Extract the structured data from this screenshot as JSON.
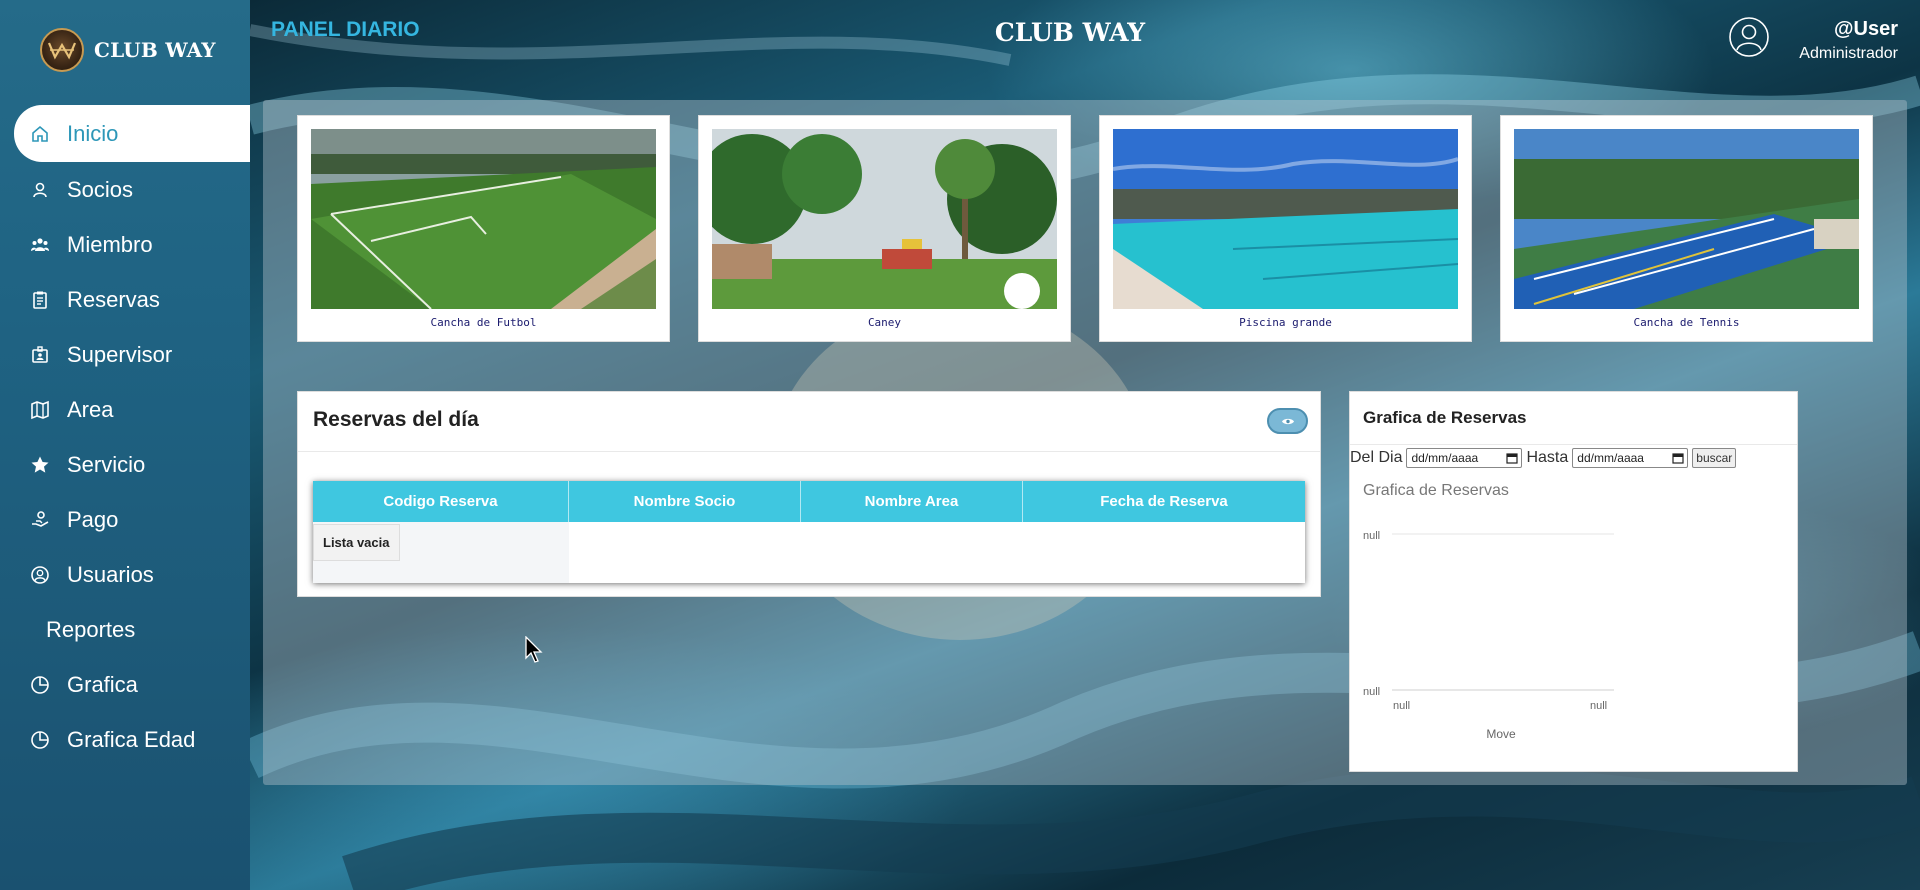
{
  "brand": {
    "name": "CLUB WAY",
    "logo_icon": "club-way-logo"
  },
  "header": {
    "panel_label": "PANEL DIARIO",
    "title": "CLUB WAY",
    "user_name": "@User",
    "user_role": "Administrador"
  },
  "sidebar": {
    "items": [
      {
        "label": "Inicio",
        "icon": "home-icon",
        "active": true
      },
      {
        "label": "Socios",
        "icon": "user-icon"
      },
      {
        "label": "Miembro",
        "icon": "members-icon"
      },
      {
        "label": "Reservas",
        "icon": "clipboard-icon"
      },
      {
        "label": "Supervisor",
        "icon": "id-badge-icon"
      },
      {
        "label": "Area",
        "icon": "map-icon"
      },
      {
        "label": "Servicio",
        "icon": "star-icon"
      },
      {
        "label": "Pago",
        "icon": "hand-coin-icon"
      },
      {
        "label": "Usuarios",
        "icon": "user-circle-icon"
      },
      {
        "label": "Reportes",
        "icon": ""
      },
      {
        "label": "Grafica",
        "icon": "pie-chart-icon"
      },
      {
        "label": "Grafica Edad",
        "icon": "pie-chart-icon"
      }
    ]
  },
  "areas": [
    {
      "caption": "Cancha de Futbol"
    },
    {
      "caption": "Caney"
    },
    {
      "caption": "Piscina grande"
    },
    {
      "caption": "Cancha de Tennis"
    }
  ],
  "reservas": {
    "title": "Reservas del día",
    "columns": [
      "Codigo Reserva",
      "Nombre Socio",
      "Nombre Area",
      "Fecha de Reserva"
    ],
    "empty_text": "Lista vacia"
  },
  "grafica": {
    "title": "Grafica de Reservas",
    "from_label": "Del Dia",
    "from_placeholder": "dd/mm/aaaa",
    "to_label": "Hasta",
    "to_placeholder": "dd/mm/aaaa",
    "search_button": "buscar",
    "subtitle": "Grafica de Reservas"
  },
  "chart_data": {
    "type": "line",
    "title": "Grafica de Reservas",
    "y_tick_labels": [
      "null",
      "null"
    ],
    "x_tick_labels": [
      "null",
      "null"
    ],
    "xlabel": "Move",
    "series": []
  },
  "colors": {
    "accent": "#3fc7e0",
    "sidebar": "#1f6383",
    "active_text": "#2d97b8",
    "panel_label": "#35b6e0"
  }
}
